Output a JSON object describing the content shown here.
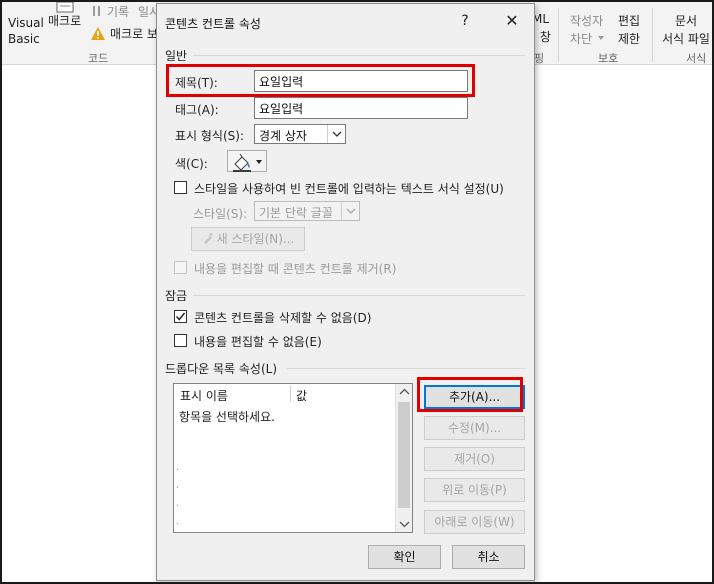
{
  "ribbon": {
    "visual_basic_label": "Visual\nBasic",
    "macro_label": "매크로",
    "record_macro": "기록",
    "pause_recording": "일시 중지",
    "macro_security": "매크로 보안",
    "code_group": "코드",
    "xml_label": "ML",
    "mapping_label": "매핑 창",
    "mapping_group": "핑",
    "block_authors_label": "작성자\n차단",
    "restrict_editing_label": "편집\n제한",
    "protect_group": "보호",
    "doc_template_label": "문서\n서식 파일",
    "template_group": "서식"
  },
  "dialog": {
    "title": "콘텐츠 컨트롤 속성",
    "help": "?",
    "close": "✕",
    "general_section": "일반",
    "title_label": "제목(T):",
    "title_value": "요일입력",
    "tag_label": "태그(A):",
    "tag_value": "요일입력",
    "display_label": "표시 형식(S):",
    "display_value": "경계 상자",
    "color_label": "색(C):",
    "use_style_label": "스타일을 사용하여 빈 컨트롤에 입력하는 텍스트 서식 설정(U)",
    "style_label": "스타일(S):",
    "style_value": "기본 단락 글꼴",
    "new_style_button": "새 스타일(N)...",
    "remove_on_edit_label": "내용을 편집할 때 콘텐츠 컨트롤 제거(R)",
    "lock_section": "잠금",
    "cannot_delete_label": "콘텐츠 컨트롤을 삭제할 수 없음(D)",
    "cannot_edit_label": "내용을 편집할 수 없음(E)",
    "dropdown_section": "드롭다운 목록 속성(L)",
    "list_col_display": "표시 이름",
    "list_col_value": "값",
    "list_row_1": "항목을 선택하세요.",
    "add_button": "추가(A)...",
    "modify_button": "수정(M)...",
    "remove_button": "제거(O)",
    "move_up_button": "위로 이동(P)",
    "move_down_button": "아래로 이동(W)",
    "ok_button": "확인",
    "cancel_button": "취소"
  },
  "colors": {
    "highlight": "#e00000",
    "dialog_bg": "#f0f0f0",
    "button_bg": "#e1e1e1",
    "primary_border": "#0078d7"
  }
}
